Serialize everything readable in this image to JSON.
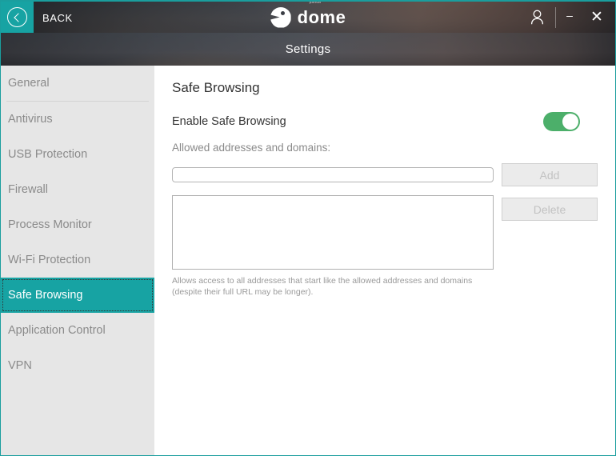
{
  "window": {
    "accent_color": "#17a3a3",
    "back_label": "BACK",
    "back_icon": "chevron-left-circle-icon",
    "user_icon": "user-account-icon",
    "minimize_label": "–",
    "close_label": "✕"
  },
  "brand": {
    "sub": "panda",
    "name": "dome",
    "logo_icon": "panda-dome-logo-icon"
  },
  "header": {
    "title": "Settings"
  },
  "sidebar": {
    "items": [
      {
        "label": "General",
        "active": false,
        "separator": true
      },
      {
        "label": "Antivirus",
        "active": false,
        "separator": false
      },
      {
        "label": "USB Protection",
        "active": false,
        "separator": false
      },
      {
        "label": "Firewall",
        "active": false,
        "separator": false
      },
      {
        "label": "Process Monitor",
        "active": false,
        "separator": false
      },
      {
        "label": "Wi-Fi Protection",
        "active": false,
        "separator": false
      },
      {
        "label": "Safe Browsing",
        "active": true,
        "separator": false
      },
      {
        "label": "Application Control",
        "active": false,
        "separator": false
      },
      {
        "label": "VPN",
        "active": false,
        "separator": false
      }
    ]
  },
  "main": {
    "page_title": "Safe Browsing",
    "toggle": {
      "label": "Enable Safe Browsing",
      "state": "on",
      "on_color": "#4caf6a"
    },
    "field_label": "Allowed addresses and domains:",
    "address_input": {
      "value": "",
      "placeholder": ""
    },
    "address_list": {
      "value": "",
      "placeholder": ""
    },
    "buttons": {
      "add": "Add",
      "delete": "Delete"
    },
    "help_text": "Allows access to all addresses that start like the allowed addresses and domains (despite their full URL may be longer)."
  }
}
